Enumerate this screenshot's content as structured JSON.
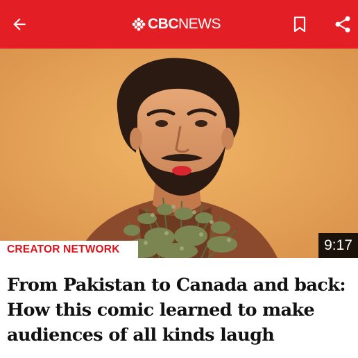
{
  "app_bar": {
    "background": "#e31e25",
    "back_icon": "arrow-left-icon",
    "logo_bold": "CBC",
    "logo_light": "NEWS",
    "bookmark_icon": "bookmark-icon",
    "share_icon": "share-icon"
  },
  "story": {
    "category": "CREATOR NETWORK",
    "category_color": "#d9121b",
    "video_duration": "9:17",
    "headline": "From Pakistan to Canada and back: How this comic learned to make audiences of all kinds laugh"
  }
}
